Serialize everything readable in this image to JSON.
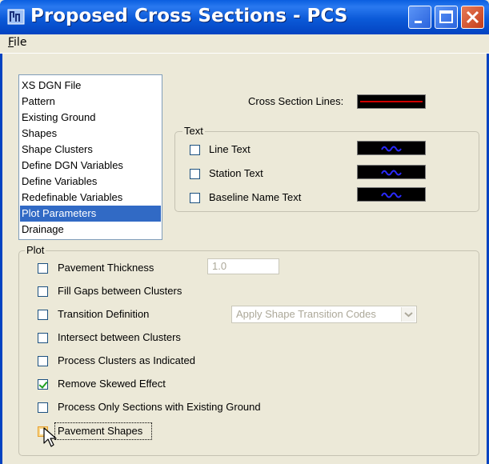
{
  "window": {
    "title": "Proposed Cross Sections - PCS",
    "minimize_icon": "minimize-icon",
    "maximize_icon": "maximize-icon",
    "close_icon": "close-icon"
  },
  "menu": {
    "file_first": "F",
    "file_rest": "ile"
  },
  "nav": {
    "items": [
      {
        "label": "XS DGN File"
      },
      {
        "label": "Pattern"
      },
      {
        "label": "Existing Ground"
      },
      {
        "label": "Shapes"
      },
      {
        "label": "Shape Clusters"
      },
      {
        "label": "Define DGN Variables"
      },
      {
        "label": "Define Variables"
      },
      {
        "label": "Redefinable Variables"
      },
      {
        "label": "Plot Parameters",
        "selected": true
      },
      {
        "label": "Drainage"
      }
    ]
  },
  "cross_section_lines": {
    "label": "Cross Section Lines:",
    "color": "#d00000"
  },
  "text_group": {
    "legend": "Text",
    "items": [
      {
        "label": "Line Text",
        "checked": false
      },
      {
        "label": "Station Text",
        "checked": false
      },
      {
        "label": "Baseline Name Text",
        "checked": false
      }
    ]
  },
  "plot_group": {
    "legend": "Plot",
    "pavement_thickness": {
      "label": "Pavement Thickness",
      "checked": false,
      "value": "1.0"
    },
    "fill_gaps": {
      "label": "Fill Gaps between Clusters",
      "checked": false
    },
    "transition_definition": {
      "label": "Transition Definition",
      "checked": false,
      "select_value": "Apply Shape Transition Codes"
    },
    "intersect": {
      "label": "Intersect between Clusters",
      "checked": false
    },
    "process_clusters": {
      "label": "Process Clusters as Indicated",
      "checked": false
    },
    "remove_skewed": {
      "label": "Remove Skewed Effect",
      "checked": true
    },
    "process_only": {
      "label": "Process Only Sections with Existing Ground",
      "checked": false
    },
    "pavement_shapes": {
      "label": "Pavement Shapes",
      "checked": false
    }
  },
  "colors": {
    "title_bar": "#0a5fe0",
    "selection": "#316ac5",
    "close_button": "#c33d1b"
  }
}
